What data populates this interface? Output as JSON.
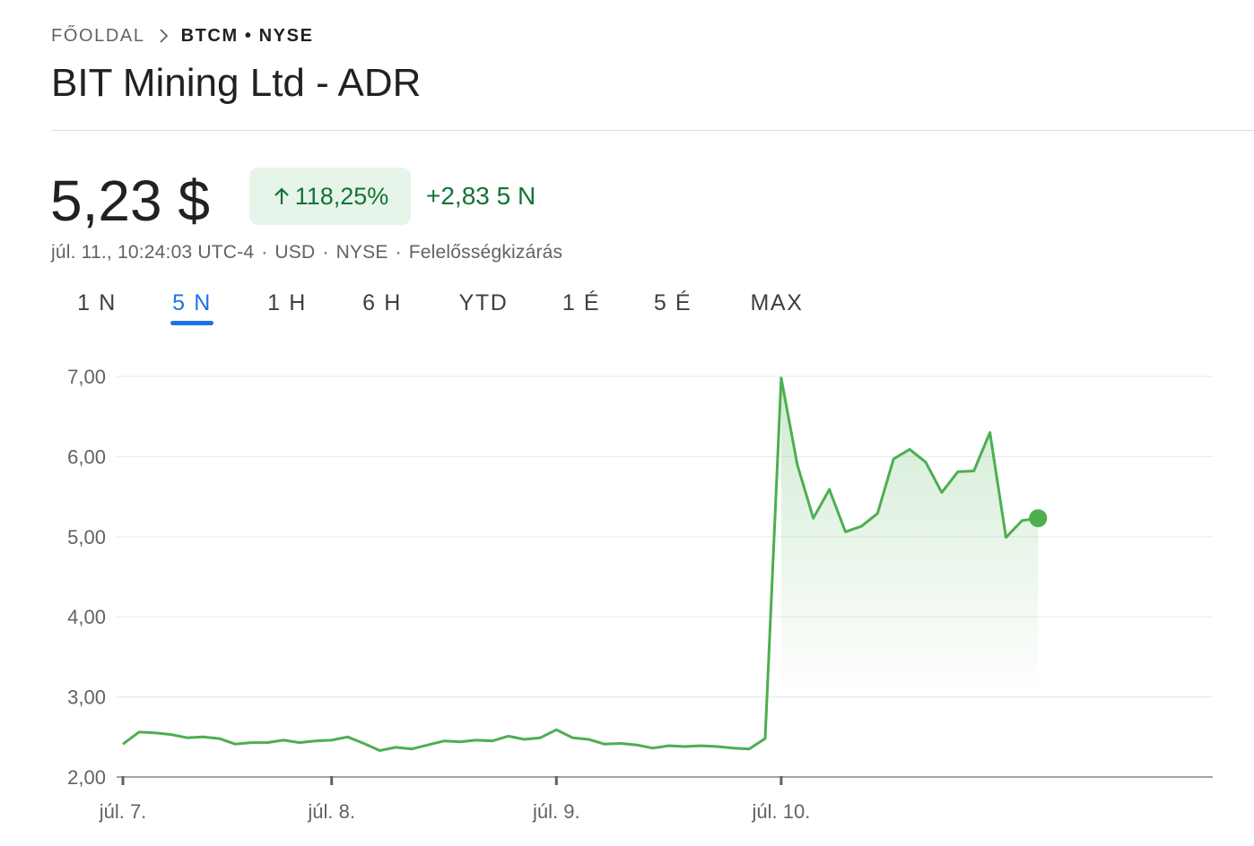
{
  "breadcrumb": {
    "home": "Főoldal",
    "current": "BTCM • NYSE"
  },
  "title": "BIT Mining Ltd - ADR",
  "quote": {
    "price": "5,23 $",
    "change_percent": "118,25%",
    "change_abs": "+2,83 5 N",
    "positive_color": "#137333",
    "badge_bg": "#e6f4ea"
  },
  "meta": {
    "timestamp": "júl. 11., 10:24:03 UTC-4",
    "currency": "USD",
    "exchange": "NYSE",
    "disclaimer": "Felelősségkizárás"
  },
  "range_tabs": {
    "items": [
      "1 N",
      "5 N",
      "1 H",
      "6 H",
      "YTD",
      "1 É",
      "5 É",
      "MAX"
    ],
    "selected": "5 N",
    "accent_color": "#1a73e8"
  },
  "icons": {
    "breadcrumb_separator": "chevron-right-icon",
    "change_direction": "arrow-up-icon"
  },
  "chart_data": {
    "type": "area",
    "series_color": "#4caf50",
    "ylim": [
      2,
      7
    ],
    "yticks": [
      2,
      3,
      4,
      5,
      6,
      7
    ],
    "ytick_labels": [
      "2,00",
      "3,00",
      "4,00",
      "5,00",
      "6,00",
      "7,00"
    ],
    "xticks": [
      0,
      13,
      27,
      41
    ],
    "xtick_labels": [
      "júl. 7.",
      "júl. 8.",
      "júl. 9.",
      "júl. 10."
    ],
    "xmax": 68,
    "grid": true,
    "fill_from_index": 41,
    "series": [
      {
        "values": [
          2.41,
          2.56,
          2.55,
          2.53,
          2.49,
          2.5,
          2.48,
          2.41,
          2.43,
          2.43,
          2.46,
          2.43,
          2.45,
          2.46,
          2.5,
          2.42,
          2.33,
          2.37,
          2.35,
          2.4,
          2.45,
          2.44,
          2.46,
          2.45,
          2.51,
          2.47,
          2.49,
          2.59,
          2.49,
          2.47,
          2.41,
          2.42,
          2.4,
          2.36,
          2.39,
          2.38,
          2.39,
          2.38,
          2.36,
          2.35,
          2.48,
          6.98,
          5.9,
          5.23,
          5.59,
          5.06,
          5.13,
          5.29,
          5.97,
          6.09,
          5.93,
          5.55,
          5.81,
          5.82,
          6.3,
          4.99,
          5.2,
          5.23
        ]
      }
    ]
  }
}
